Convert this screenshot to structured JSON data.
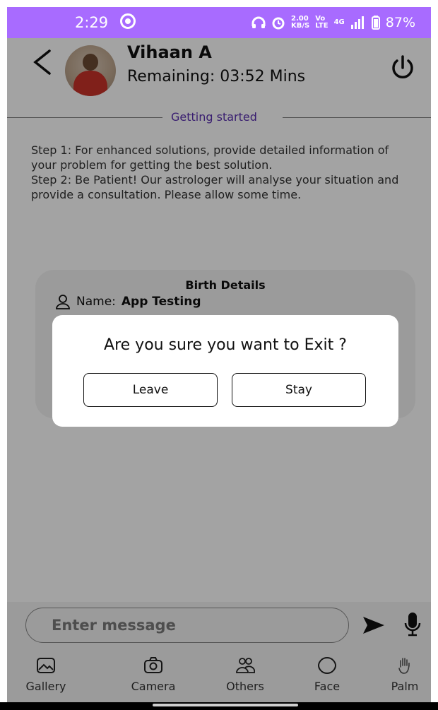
{
  "status_bar": {
    "time": "2:29",
    "net_speed_top": "2.00",
    "net_speed_bottom": "KB/S",
    "vo_top": "Vo",
    "vo_bottom": "LTE",
    "network": "4G",
    "battery": "87%",
    "bg_color": "#a86bff"
  },
  "header": {
    "name": "Vihaan A",
    "remaining": "Remaining: 03:52  Mins"
  },
  "getting_started": {
    "label": "Getting started",
    "step1": "Step 1: For enhanced solutions, provide detailed information of your problem for getting the best solution.",
    "step2": "Step 2: Be Patient! Our astrologer will analyse your situation and provide a consultation. Please allow some time."
  },
  "birth_details": {
    "title": "Birth Details",
    "name_label": "Name:",
    "name_value": "App Testing"
  },
  "dialog": {
    "title": "Are you sure you want to Exit ?",
    "leave": "Leave",
    "stay": "Stay"
  },
  "composer": {
    "placeholder": "Enter message"
  },
  "toolbar": {
    "items": [
      {
        "label": "Gallery",
        "icon": "gallery-icon"
      },
      {
        "label": "Camera",
        "icon": "camera-icon"
      },
      {
        "label": "Others",
        "icon": "others-icon"
      },
      {
        "label": "Face",
        "icon": "face-icon"
      },
      {
        "label": "Palm",
        "icon": "palm-icon"
      }
    ]
  },
  "colors": {
    "accent": "#5a2fb0",
    "status_bar": "#a86bff"
  }
}
